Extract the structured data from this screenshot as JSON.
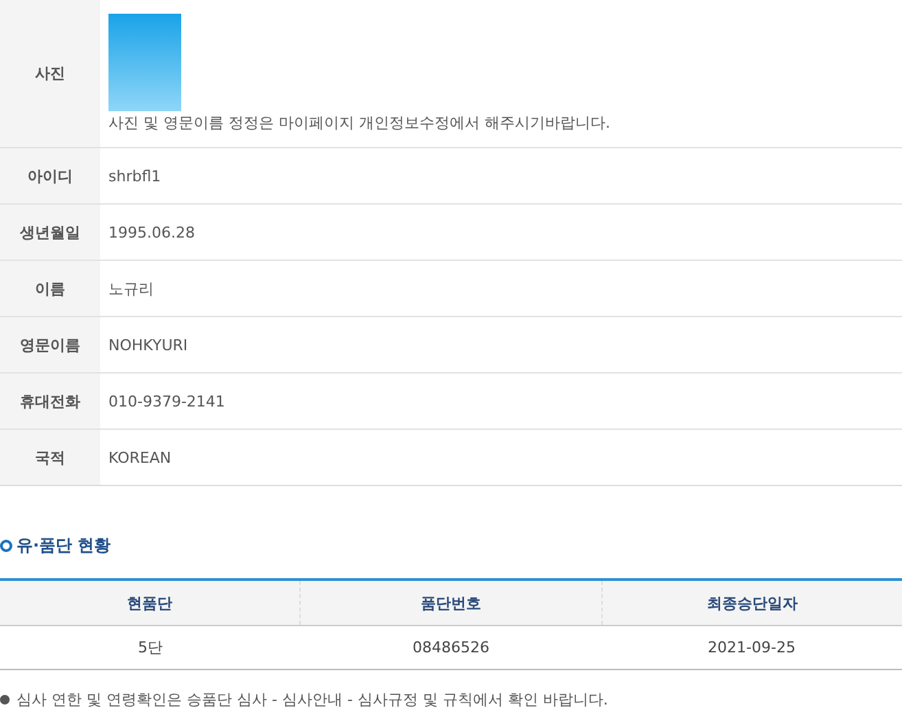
{
  "profile": {
    "photo_label": "사진",
    "photo_note": "사진 및 영문이름 정정은 마이페이지 개인정보수정에서 해주시기바랍니다.",
    "fields": [
      {
        "label": "아이디",
        "value": "shrbfl1"
      },
      {
        "label": "생년월일",
        "value": "1995.06.28"
      },
      {
        "label": "이름",
        "value": "노규리"
      },
      {
        "label": "영문이름",
        "value": "NOHKYURI"
      },
      {
        "label": "휴대전화",
        "value": "010-9379-2141"
      },
      {
        "label": "국적",
        "value": "KOREAN"
      }
    ]
  },
  "section_title": "유·품단 현황",
  "table": {
    "columns": [
      "현품단",
      "품단번호",
      "최종승단일자"
    ],
    "rows": [
      [
        "5단",
        "08486526",
        "2021-09-25"
      ]
    ]
  },
  "note": "심사 연한 및 연령확인은 승품단 심사 - 심사안내 - 심사규정 및 규칙에서 확인 바랍니다."
}
